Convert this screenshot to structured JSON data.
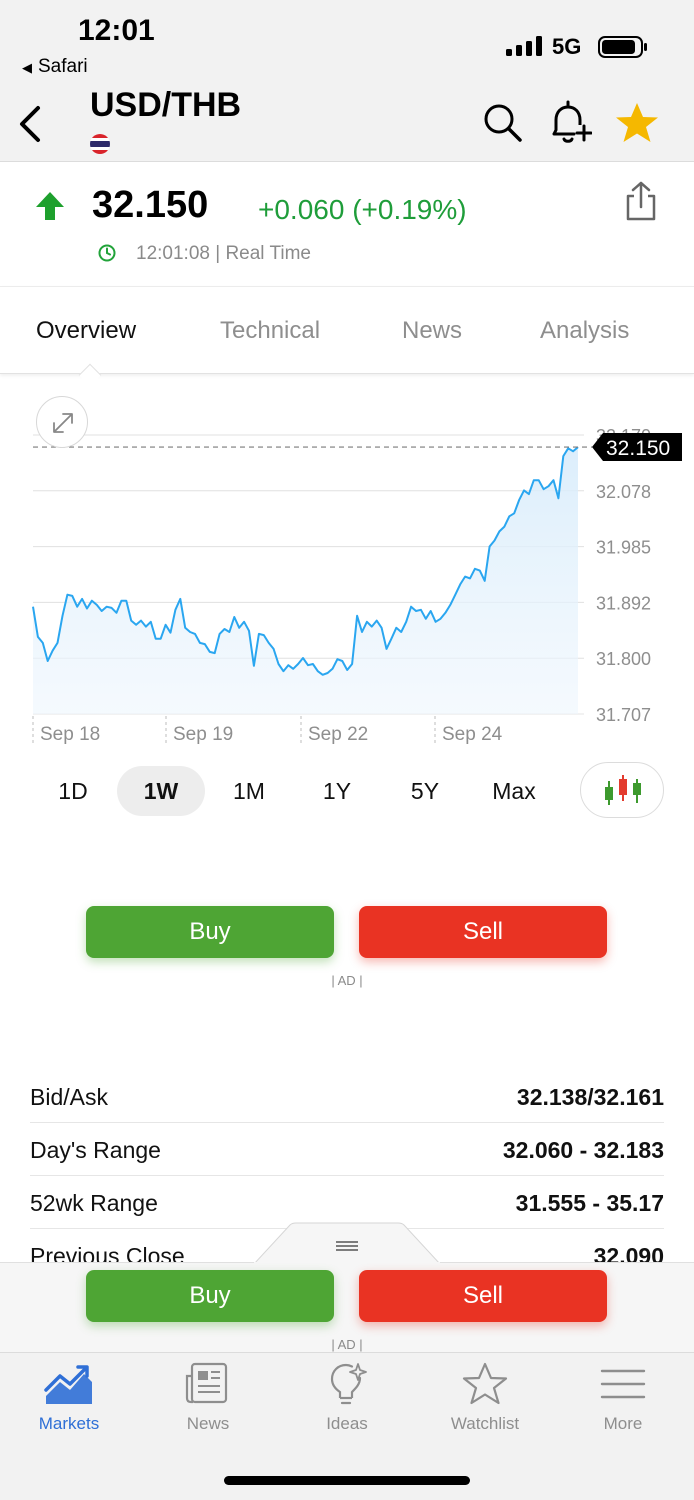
{
  "status_bar": {
    "time": "12:01",
    "back_app": "Safari",
    "network": "5G"
  },
  "header": {
    "title": "USD/THB"
  },
  "quote": {
    "price": "32.150",
    "change": "+0.060 (+0.19%)",
    "time_info": "12:01:08 | Real Time"
  },
  "tabs": [
    {
      "label": "Overview"
    },
    {
      "label": "Technical"
    },
    {
      "label": "News"
    },
    {
      "label": "Analysis"
    }
  ],
  "chart_data": {
    "type": "area",
    "y_ticks": [
      "32.170",
      "32.078",
      "31.985",
      "31.892",
      "31.800",
      "31.707"
    ],
    "x_labels": [
      "Sep 18",
      "Sep 19",
      "Sep 22",
      "Sep 24"
    ],
    "ylim": [
      31.707,
      32.17
    ],
    "current_label": "32.150",
    "current_value": 32.15,
    "values": [
      31.885,
      31.835,
      31.825,
      31.795,
      31.812,
      31.825,
      31.87,
      31.905,
      31.903,
      31.885,
      31.898,
      31.882,
      31.895,
      31.888,
      31.878,
      31.885,
      31.883,
      31.875,
      31.895,
      31.895,
      31.862,
      31.855,
      31.862,
      31.852,
      31.86,
      31.832,
      31.832,
      31.855,
      31.842,
      31.88,
      31.898,
      31.85,
      31.843,
      31.84,
      31.825,
      31.823,
      31.81,
      31.808,
      31.84,
      31.848,
      31.843,
      31.868,
      31.85,
      31.86,
      31.845,
      31.787,
      31.84,
      31.838,
      31.825,
      31.815,
      31.79,
      31.778,
      31.788,
      31.782,
      31.79,
      31.8,
      31.788,
      31.79,
      31.778,
      31.772,
      31.775,
      31.782,
      31.798,
      31.795,
      31.78,
      31.79,
      31.87,
      31.843,
      31.86,
      31.852,
      31.862,
      31.85,
      31.815,
      31.832,
      31.85,
      31.843,
      31.86,
      31.885,
      31.878,
      31.88,
      31.865,
      31.878,
      31.86,
      31.865,
      31.875,
      31.888,
      31.905,
      31.922,
      31.935,
      31.932,
      31.948,
      31.945,
      31.928,
      31.985,
      31.995,
      32.01,
      32.018,
      32.035,
      32.04,
      32.062,
      32.078,
      32.072,
      32.095,
      32.095,
      32.08,
      32.085,
      32.095,
      32.065,
      32.135,
      32.148,
      32.143,
      32.15
    ]
  },
  "ranges": [
    {
      "label": "1D"
    },
    {
      "label": "1W"
    },
    {
      "label": "1M"
    },
    {
      "label": "1Y"
    },
    {
      "label": "5Y"
    },
    {
      "label": "Max"
    }
  ],
  "trade": {
    "buy": "Buy",
    "sell": "Sell",
    "ad": "| AD |"
  },
  "stats": [
    {
      "label": "Bid/Ask",
      "value": "32.138/32.161"
    },
    {
      "label": "Day's Range",
      "value": "32.060 - 32.183"
    },
    {
      "label": "52wk Range",
      "value": "31.555 - 35.17"
    },
    {
      "label": "Previous Close",
      "value": "32.090"
    }
  ],
  "bottom_nav": [
    {
      "label": "Markets"
    },
    {
      "label": "News"
    },
    {
      "label": "Ideas"
    },
    {
      "label": "Watchlist"
    },
    {
      "label": "More"
    }
  ],
  "colors": {
    "up": "#1f9d3a",
    "down": "#e93323",
    "buy": "#4ea534",
    "line": "#2aa6f0",
    "accent": "#2f6fd6",
    "star": "#f5b800"
  }
}
